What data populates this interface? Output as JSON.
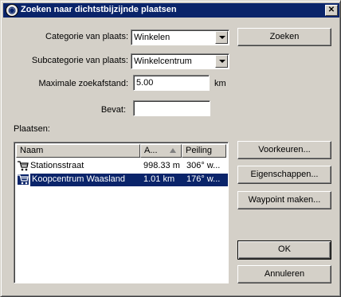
{
  "window": {
    "title": "Zoeken naar dichtstbijzijnde plaatsen",
    "close_symbol": "✕"
  },
  "form": {
    "category_label": "Categorie van plaats:",
    "category_value": "Winkelen",
    "subcategory_label": "Subcategorie van plaats:",
    "subcategory_value": "Winkelcentrum",
    "distance_label": "Maximale zoekafstand:",
    "distance_value": "5.00",
    "distance_unit": "km",
    "contains_label": "Bevat:",
    "contains_value": "",
    "places_label": "Plaatsen:"
  },
  "list": {
    "columns": [
      {
        "label": "Naam"
      },
      {
        "label": "A..."
      },
      {
        "label": "Peiling"
      }
    ],
    "rows": [
      {
        "name": "Stationsstraat",
        "distance": "998.33 m",
        "bearing": "306° w...",
        "icon": "shopping-cart-icon",
        "selected": false
      },
      {
        "name": "Koopcentrum Waasland",
        "distance": "1.01 km",
        "bearing": "176° w...",
        "icon": "shopping-cart-icon",
        "selected": true
      }
    ]
  },
  "buttons": {
    "search": "Zoeken",
    "preferences": "Voorkeuren...",
    "properties": "Eigenschappen...",
    "create_waypoint": "Waypoint maken...",
    "ok": "OK",
    "cancel": "Annuleren"
  },
  "colors": {
    "title_bar": "#0a246a",
    "selection": "#0a246a",
    "face": "#d4d0c8"
  }
}
